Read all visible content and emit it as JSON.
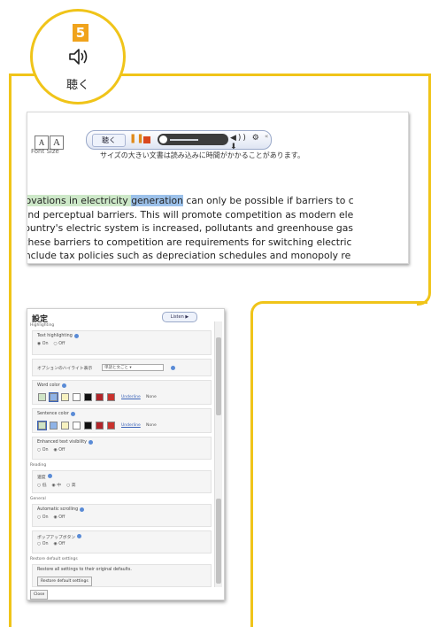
{
  "badge": {
    "number": "5",
    "icon": "speaker-icon",
    "label": "聴く"
  },
  "toolbar": {
    "font_small": "A",
    "font_large": "A",
    "font_size_label": "Font Size",
    "listen_label": "聴く",
    "pause_glyph": "❚❚",
    "tools_glyphs": "◀)) ⚙ ⬇",
    "close_glyph": "«",
    "caption": "サイズの大きい文書は読み込みに時間がかかることがあります。"
  },
  "article": {
    "line1_before": "cal innovations in electricity ",
    "line1_word": "generation",
    "line1_after": " can only be possible if barriers to c",
    "line2": "atory and perceptual barriers. This will promote competition as modern ele",
    "line3": "f the country's electric system is increased, pollutants and greenhouse gas",
    "line4": "mong these barriers to competition are requirements for switching electric",
    "line5": "rriers include tax policies such as depreciation schedules and monopoly re"
  },
  "settings": {
    "title": "設定",
    "listen_label": "Listen ▶",
    "section_highlighting": "Highlighting",
    "text_highlighting_label": "Text highlighting",
    "on_label": "On",
    "off_label": "Off",
    "highlight_option_label": "オプションのハイライト表示",
    "highlight_option_value": "単語と文ごと",
    "word_color_label": "Word color",
    "sentence_color_label": "Sentence color",
    "underline_label": "Underline",
    "none_label": "None",
    "enhanced_visibility_label": "Enhanced text visibility",
    "section_reading": "Reading",
    "speed_label": "速度",
    "speed_options": [
      "低",
      "中",
      "高"
    ],
    "section_general": "General",
    "auto_scroll_label": "Automatic scrolling",
    "popup_button_label": "ポップアップボタン",
    "section_restore": "Restore default settings",
    "restore_text": "Restore all settings to their original defaults.",
    "restore_button": "Restore default settings",
    "close_button": "Close"
  },
  "colors": {
    "frame": "#f0c419",
    "badge_number_bg": "#f0a31c",
    "sentence_highlight": "#cde8c8",
    "word_highlight": "#9cc1ea",
    "swatches": [
      "#cfe4c6",
      "#8fb3e6",
      "#f7f2c0",
      "#ffffff",
      "#111111",
      "#b2252a",
      "#c9332e"
    ]
  }
}
